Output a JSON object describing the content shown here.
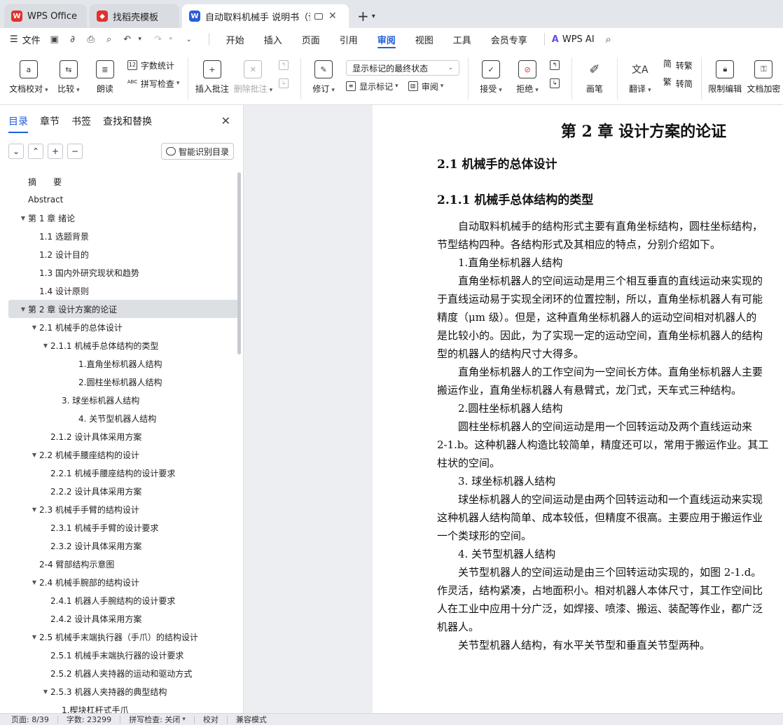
{
  "tabs": [
    {
      "label": "WPS Office",
      "icon": "wps-logo-icon",
      "color": "#e5302b"
    },
    {
      "label": "找稻壳模板",
      "icon": "docer-logo-icon",
      "color": "#e5302b"
    },
    {
      "label": "自动取料机械手 说明书（论文",
      "icon": "word-doc-icon",
      "color": "#2a5ed6"
    }
  ],
  "menu": {
    "file": "文件",
    "tabs": [
      "开始",
      "插入",
      "页面",
      "引用",
      "审阅",
      "视图",
      "工具",
      "会员专享"
    ],
    "active_tab": "审阅",
    "wps_ai": "WPS AI"
  },
  "ribbon": {
    "doc_proof": "文档校对",
    "compare": "比较",
    "read_aloud": "朗读",
    "word_count": "字数统计",
    "spell_check": "拼写检查",
    "insert_comment": "插入批注",
    "delete_comment": "删除批注",
    "revise": "修订",
    "markup_state": "显示标记的最终状态",
    "show_markup": "显示标记",
    "review": "审阅",
    "accept": "接受",
    "reject": "拒绝",
    "pen": "画笔",
    "translate": "翻译",
    "to_traditional": "转繁",
    "to_simplified": "转简",
    "restrict_edit": "限制编辑",
    "doc_encrypt": "文档加密"
  },
  "panel": {
    "tabs": [
      "目录",
      "章节",
      "书签",
      "查找和替换"
    ],
    "active_tab": "目录",
    "smart_toc": "智能识别目录",
    "toc": [
      {
        "text": "摘　　要",
        "level": 0,
        "arrow": false
      },
      {
        "text": "Abstract",
        "level": 0,
        "arrow": false
      },
      {
        "text": "第 1 章  绪论",
        "level": 0,
        "arrow": true
      },
      {
        "text": "1.1  选题背景",
        "level": 1,
        "arrow": false
      },
      {
        "text": "1.2  设计目的",
        "level": 1,
        "arrow": false
      },
      {
        "text": "1.3  国内外研究现状和趋势",
        "level": 1,
        "arrow": false
      },
      {
        "text": "1.4  设计原则",
        "level": 1,
        "arrow": false
      },
      {
        "text": "第 2 章  设计方案的论证",
        "level": 0,
        "arrow": true,
        "selected": true
      },
      {
        "text": "2.1 机械手的总体设计",
        "level": 1,
        "arrow": true
      },
      {
        "text": "2.1.1  机械手总体结构的类型",
        "level": 2,
        "arrow": true
      },
      {
        "text": "1.直角坐标机器人结构",
        "level": 4,
        "arrow": false
      },
      {
        "text": "2.圆柱坐标机器人结构",
        "level": 4,
        "arrow": false
      },
      {
        "text": "3.  球坐标机器人结构",
        "level": 3,
        "arrow": false
      },
      {
        "text": "4.  关节型机器人结构",
        "level": 4,
        "arrow": false
      },
      {
        "text": "2.1.2  设计具体采用方案",
        "level": 2,
        "arrow": false
      },
      {
        "text": "2.2  机械手腰座结构的设计",
        "level": 1,
        "arrow": true
      },
      {
        "text": "2.2.1  机械手腰座结构的设计要求",
        "level": 2,
        "arrow": false
      },
      {
        "text": "2.2.2  设计具体采用方案",
        "level": 2,
        "arrow": false
      },
      {
        "text": "2.3  机械手手臂的结构设计",
        "level": 1,
        "arrow": true
      },
      {
        "text": "2.3.1  机械手手臂的设计要求",
        "level": 2,
        "arrow": false
      },
      {
        "text": "2.3.2  设计具体采用方案",
        "level": 2,
        "arrow": false
      },
      {
        "text": "2-4  臂部结构示意图",
        "level": 1,
        "arrow": false
      },
      {
        "text": "2.4  机械手腕部的结构设计",
        "level": 1,
        "arrow": true
      },
      {
        "text": "2.4.1  机器人手腕结构的设计要求",
        "level": 2,
        "arrow": false
      },
      {
        "text": "2.4.2 设计具体采用方案",
        "level": 2,
        "arrow": false
      },
      {
        "text": "2.5 机械手末端执行器（手爪）的结构设计",
        "level": 1,
        "arrow": true
      },
      {
        "text": "2.5.1 机械手末端执行器的设计要求",
        "level": 2,
        "arrow": false
      },
      {
        "text": "2.5.2 机器人夹持器的运动和驱动方式",
        "level": 2,
        "arrow": false
      },
      {
        "text": "2.5.3  机器人夹持器的典型结构",
        "level": 2,
        "arrow": true
      },
      {
        "text": "1.楔块杠杆式手爪",
        "level": 3,
        "arrow": false
      }
    ]
  },
  "document": {
    "chapter_title": "第 2 章  设计方案的论证",
    "section_title": "2.1 机械手的总体设计",
    "subsection_title": "2.1.1  机械手总体结构的类型",
    "paragraphs": [
      "　　自动取料机械手的结构形式主要有直角坐标结构，圆柱坐标结构，",
      "节型结构四种。各结构形式及其相应的特点，分别介绍如下。",
      "　　1.直角坐标机器人结构",
      "　　直角坐标机器人的空间运动是用三个相互垂直的直线运动来实现的",
      "于直线运动易于实现全闭环的位置控制，所以，直角坐标机器人有可能",
      "精度（μm 级）。但是，这种直角坐标机器人的运动空间相对机器人的",
      "是比较小的。因此，为了实现一定的运动空间，直角坐标机器人的结构",
      "型的机器人的结构尺寸大得多。",
      "　　直角坐标机器人的工作空间为一空间长方体。直角坐标机器人主要",
      "搬运作业，直角坐标机器人有悬臂式，龙门式，天车式三种结构。",
      "　　2.圆柱坐标机器人结构",
      "　　圆柱坐标机器人的空间运动是用一个回转运动及两个直线运动来",
      "2-1.b。这种机器人构造比较简单，精度还可以，常用于搬运作业。其工",
      "柱状的空间。",
      "　　3.  球坐标机器人结构",
      "　　球坐标机器人的空间运动是由两个回转运动和一个直线运动来实现",
      "这种机器人结构简单、成本较低，但精度不很高。主要应用于搬运作业",
      "一个类球形的空间。",
      "　　4.  关节型机器人结构",
      "　　关节型机器人的空间运动是由三个回转运动实现的，如图 2-1.d。",
      "作灵活，结构紧凑，占地面积小。相对机器人本体尺寸，其工作空间比",
      "人在工业中应用十分广泛，如焊接、喷漆、搬运、装配等作业，都广泛",
      "机器人。",
      "　　关节型机器人结构，有水平关节型和垂直关节型两种。"
    ]
  },
  "status": {
    "page": "页面: 8/39",
    "words": "字数: 23299",
    "spell": "拼写检查: 关闭",
    "proof": "校对",
    "compat": "兼容模式"
  },
  "colors": {
    "accent": "#1f5fd6",
    "wps_red": "#e5302b"
  }
}
